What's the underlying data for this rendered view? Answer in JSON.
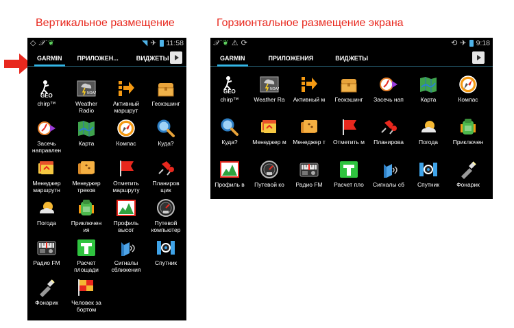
{
  "captions": {
    "vertical": "Вертикальное размещение",
    "horizontal": "Горзионтальное размещение экрана"
  },
  "colors": {
    "caption": "#e8281e",
    "tab_indicator": "#33b5e5",
    "arrow": "#e8281e"
  },
  "vertical_screen": {
    "status": {
      "time": "11:58",
      "icons": [
        "diamond-icon",
        "ant-logo-icon",
        "leaf-icon",
        "wifi-icon",
        "airplane-icon",
        "battery-icon"
      ]
    },
    "tabs": [
      "GARMIN",
      "ПРИЛОЖЕН...",
      "ВИДЖЕТЫ"
    ],
    "store_icon": "play-store-icon",
    "apps": [
      {
        "label": "chirp™",
        "icon": "chirp-geo-icon"
      },
      {
        "label": "Weather Radio",
        "icon": "weather-radio-icon"
      },
      {
        "label": "Активный маршрут",
        "icon": "active-route-icon"
      },
      {
        "label": "Геокэшинг",
        "icon": "treasure-chest-icon"
      },
      {
        "label": "Засечь направлен",
        "icon": "sight-n-go-icon"
      },
      {
        "label": "Карта",
        "icon": "map-icon"
      },
      {
        "label": "Компас",
        "icon": "compass-icon"
      },
      {
        "label": "Куда?",
        "icon": "magnifier-icon"
      },
      {
        "label": "Менеджер маршрутн",
        "icon": "route-manager-icon"
      },
      {
        "label": "Менеджер треков",
        "icon": "track-manager-icon"
      },
      {
        "label": "Отметить маршруту",
        "icon": "mark-waypoint-icon"
      },
      {
        "label": "Планиров щик",
        "icon": "planner-pins-icon"
      },
      {
        "label": "Погода",
        "icon": "weather-icon"
      },
      {
        "label": "Приключен ия",
        "icon": "adventures-icon"
      },
      {
        "label": "Профиль высот",
        "icon": "elevation-profile-icon"
      },
      {
        "label": "Путевой компьютер",
        "icon": "trip-computer-icon"
      },
      {
        "label": "Радио FM",
        "icon": "fm-radio-icon"
      },
      {
        "label": "Расчет площади",
        "icon": "area-calc-icon"
      },
      {
        "label": "Сигналы сближения",
        "icon": "proximity-alarm-icon"
      },
      {
        "label": "Спутник",
        "icon": "satellite-icon"
      },
      {
        "label": "Фонарик",
        "icon": "flashlight-icon"
      },
      {
        "label": "Человек за бортом",
        "icon": "man-overboard-icon"
      }
    ]
  },
  "horizontal_screen": {
    "status": {
      "time": "9:18",
      "icons": [
        "ant-logo-icon",
        "leaf-icon",
        "warning-icon",
        "sync-icon",
        "rotate-icon",
        "airplane-icon",
        "battery-icon"
      ]
    },
    "tabs": [
      "GARMIN",
      "ПРИЛОЖЕНИЯ",
      "ВИДЖЕТЫ"
    ],
    "store_icon": "play-store-icon",
    "apps": [
      {
        "label": "chirp™",
        "icon": "chirp-geo-icon"
      },
      {
        "label": "Weather Ra",
        "icon": "weather-radio-icon"
      },
      {
        "label": "Активный м",
        "icon": "active-route-icon"
      },
      {
        "label": "Геокэшинг",
        "icon": "treasure-chest-icon"
      },
      {
        "label": "Засечь нап",
        "icon": "sight-n-go-icon"
      },
      {
        "label": "Карта",
        "icon": "map-icon"
      },
      {
        "label": "Компас",
        "icon": "compass-icon"
      },
      {
        "label": "Куда?",
        "icon": "magnifier-icon"
      },
      {
        "label": "Менеджер м",
        "icon": "route-manager-icon"
      },
      {
        "label": "Менеджер т",
        "icon": "track-manager-icon"
      },
      {
        "label": "Отметить м",
        "icon": "mark-waypoint-icon"
      },
      {
        "label": "Планирова",
        "icon": "planner-pins-icon"
      },
      {
        "label": "Погода",
        "icon": "weather-icon"
      },
      {
        "label": "Приключен",
        "icon": "adventures-icon"
      },
      {
        "label": "Профиль в",
        "icon": "elevation-profile-icon"
      },
      {
        "label": "Путевой ко",
        "icon": "trip-computer-icon"
      },
      {
        "label": "Радио FM",
        "icon": "fm-radio-icon"
      },
      {
        "label": "Расчет пло",
        "icon": "area-calc-icon"
      },
      {
        "label": "Сигналы сб",
        "icon": "proximity-alarm-icon"
      },
      {
        "label": "Спутник",
        "icon": "satellite-icon"
      },
      {
        "label": "Фонарик",
        "icon": "flashlight-icon"
      }
    ]
  }
}
